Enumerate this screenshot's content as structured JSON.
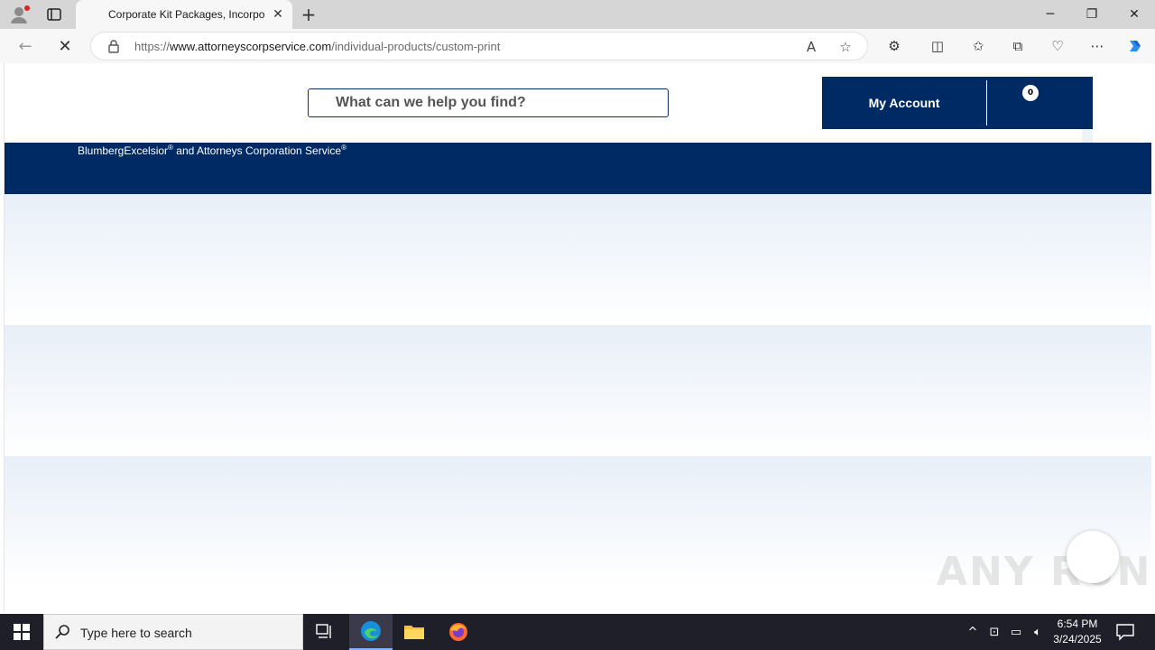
{
  "browser": {
    "tab_title": "Corporate Kit Packages, Incorporation Supplies",
    "url_prefix": "https://",
    "url_host": "www.attorneyscorpservice.com",
    "url_path": "/individual-products/custom-print"
  },
  "site": {
    "search_placeholder": "What can we help you find?",
    "account_label": "My Account",
    "cart_count": "0",
    "band_text_part1": "BlumbergExcelsior",
    "band_text_mark": "®",
    "band_text_part2": " and Attorneys Corporation Service",
    "band_text_mark2": "®"
  },
  "watermark": "ANY RUN",
  "taskbar": {
    "search_placeholder": "Type here to search",
    "time": "6:54 PM",
    "date": "3/24/2025"
  },
  "colors": {
    "brand_navy": "#002a63",
    "taskbar": "#1f1f2a"
  }
}
